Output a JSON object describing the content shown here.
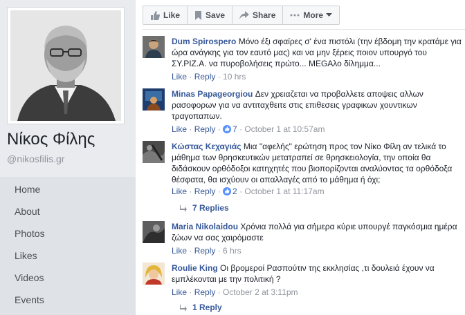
{
  "profile": {
    "name": "Νίκος Φίλης",
    "handle": "@nikosfilis.gr"
  },
  "nav": [
    "Home",
    "About",
    "Photos",
    "Likes",
    "Videos",
    "Events"
  ],
  "actions": {
    "like": "Like",
    "save": "Save",
    "share": "Share",
    "more": "More"
  },
  "comments": [
    {
      "author": "Dum Spirospero",
      "text": "Μόνο έξι σφαίρες σ' ένα πιστόλι (την έβδομη την κρατάμε για ώρα ανάγκης για τον εαυτό μας) και να μην ξέρεις ποιον υπουργό του ΣΥ.ΡΙΖ.Α. να πυροβολήσεις πρώτο... MEGAλο δίλημμα...",
      "like": "Like",
      "reply": "Reply",
      "count": "",
      "time": "10 hrs"
    },
    {
      "author": "Minas Papageorgiou",
      "text": "Δεν χρειαζεται να προβαλλετε αποψεις αλλων ρασοφορων για να αντιταχθειτε στις επιθεσεις γραφικων χουντικων τραγοπαπων.",
      "like": "Like",
      "reply": "Reply",
      "count": "7",
      "time": "October 1 at 10:57am"
    },
    {
      "author": "Κώστας Κεχαγιάς",
      "text": "Μια \"αφελής\" ερώτηση προς τον Νίκο Φίλη αν τελικά το μάθημα των θρησκευτικών μετατραπεί σε θρησκειολογία, την οποία θα διδάσκουν ορθόδοξοι κατηχητές που βιοπορίζονται αναλύοντας τα ορθόδοξα θέσφατα, θα ισχύουν οι απαλλαγές από το μάθημα ή όχι;",
      "like": "Like",
      "reply": "Reply",
      "count": "2",
      "time": "October 1 at 11:17am",
      "replies": "7 Replies"
    },
    {
      "author": "Maria Nikolaidou",
      "text": "Χρόνια πολλά για σήμερα κύριε υπουργέ παγκόσμια ημέρα ζώων να σας χαιρόμαστε",
      "like": "Like",
      "reply": "Reply",
      "count": "",
      "time": "6 hrs"
    },
    {
      "author": "Roulie King",
      "text": "Οι βρομεροί Ρασπούτιν της εκκλησίας ,τι δουλειά έχουν να εμπλέκονται με την πολιτική ?",
      "like": "Like",
      "reply": "Reply",
      "count": "",
      "time": "October 2 at 3:11pm",
      "replies": "1 Reply"
    }
  ]
}
